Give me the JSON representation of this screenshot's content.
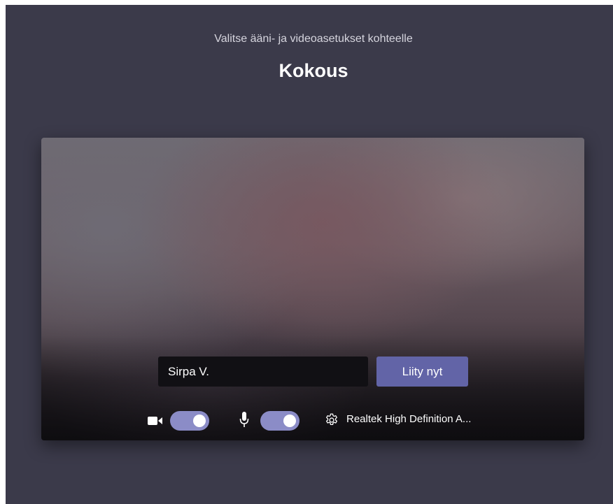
{
  "header": {
    "subtitle": "Valitse ääni- ja videoasetukset kohteelle",
    "meeting_title": "Kokous"
  },
  "prejoin": {
    "name_value": "Sirpa V.",
    "join_label": "Liity nyt",
    "camera_toggle": {
      "icon": "video-camera-icon",
      "on": true
    },
    "mic_toggle": {
      "icon": "microphone-icon",
      "on": true
    },
    "device": {
      "icon": "gear-icon",
      "label": "Realtek High Definition A..."
    }
  },
  "colors": {
    "background": "#3b3a4a",
    "accent": "#6264a7",
    "toggle_on": "#8b8cc7",
    "input_bg": "#111014"
  }
}
